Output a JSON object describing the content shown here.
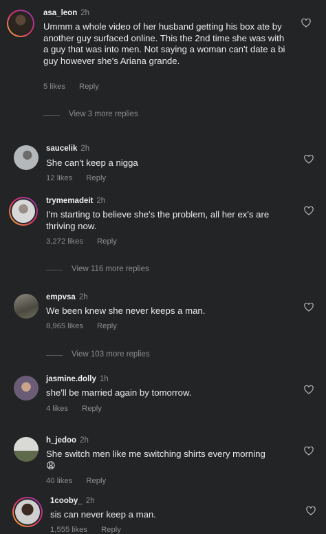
{
  "comments": [
    {
      "username": "asa_leon",
      "time": "2h",
      "text": "Ummm a whole video of her husband getting his box ate by another guy surfaced online. This the 2nd time she was with a guy that was into men. Not saying a woman can't date a bi guy however she's Ariana grande.",
      "likes": "5 likes",
      "reply": "Reply",
      "view_replies": "View 3 more replies"
    },
    {
      "username": "saucelik",
      "time": "2h",
      "text": "She can't keep a nigga",
      "likes": "12 likes",
      "reply": "Reply"
    },
    {
      "username": "trymemadeit",
      "time": "2h",
      "text": "I'm starting to believe she's the problem, all her ex's are thriving now.",
      "likes": "3,272 likes",
      "reply": "Reply",
      "view_replies": "View 116 more replies"
    },
    {
      "username": "empvsa",
      "time": "2h",
      "text": "We been knew she never keeps a man.",
      "likes": "8,965 likes",
      "reply": "Reply",
      "view_replies": "View 103 more replies"
    },
    {
      "username": "jasmine.dolly",
      "time": "1h",
      "text": "she'll be married again by tomorrow.",
      "likes": "4 likes",
      "reply": "Reply"
    },
    {
      "username": "h_jedoo",
      "time": "2h",
      "text": "She switch men like me switching shirts every morning 😩",
      "likes": "40 likes",
      "reply": "Reply"
    },
    {
      "username": "1cooby_",
      "time": "2h",
      "text": "sis can never keep a man.",
      "likes": "1,555 likes",
      "reply": "Reply"
    }
  ],
  "icons": {
    "like": "heart-outline-icon"
  },
  "colors": {
    "background": "#232425",
    "secondary_text": "#8e8e8e",
    "primary_text": "#f2f2f2"
  }
}
